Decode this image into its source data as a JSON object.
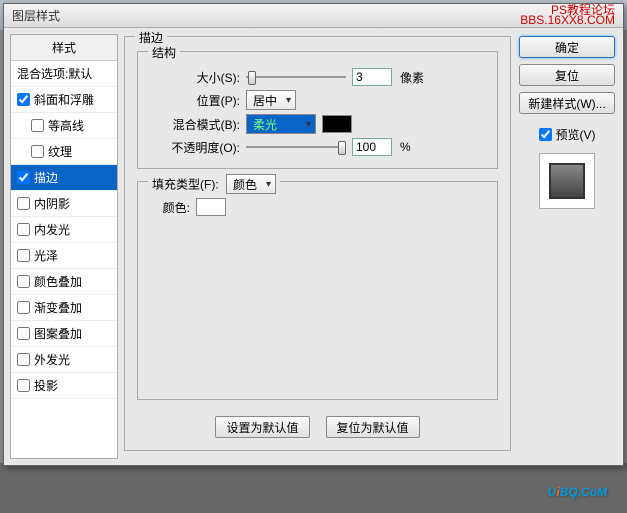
{
  "titlebar": {
    "title": "图层样式",
    "right1": "PS教程论坛",
    "right2": "BBS.16XX8.COM"
  },
  "left": {
    "header": "样式",
    "blend_defaults": "混合选项:默认",
    "items": [
      {
        "label": "斜面和浮雕",
        "checked": true,
        "indent": false
      },
      {
        "label": "等高线",
        "checked": false,
        "indent": true
      },
      {
        "label": "纹理",
        "checked": false,
        "indent": true
      },
      {
        "label": "描边",
        "checked": true,
        "indent": false,
        "selected": true
      },
      {
        "label": "内阴影",
        "checked": false,
        "indent": false
      },
      {
        "label": "内发光",
        "checked": false,
        "indent": false
      },
      {
        "label": "光泽",
        "checked": false,
        "indent": false
      },
      {
        "label": "颜色叠加",
        "checked": false,
        "indent": false
      },
      {
        "label": "渐变叠加",
        "checked": false,
        "indent": false
      },
      {
        "label": "图案叠加",
        "checked": false,
        "indent": false
      },
      {
        "label": "外发光",
        "checked": false,
        "indent": false
      },
      {
        "label": "投影",
        "checked": false,
        "indent": false
      }
    ]
  },
  "mid": {
    "section_title": "描边",
    "structure_title": "结构",
    "size_label": "大小(S):",
    "size_value": "3",
    "size_unit": "像素",
    "position_label": "位置(P):",
    "position_value": "居中",
    "blend_label": "混合模式(B):",
    "blend_value": "柔光",
    "opacity_label": "不透明度(O):",
    "opacity_value": "100",
    "opacity_unit": "%",
    "filltype_title_label": "填充类型(F):",
    "filltype_value": "颜色",
    "color_label": "颜色:",
    "set_default": "设置为默认值",
    "reset_default": "复位为默认值"
  },
  "right": {
    "ok": "确定",
    "cancel": "复位",
    "new_style": "新建样式(W)...",
    "preview": "预览(V)"
  },
  "watermark": {
    "text_pre": "U",
    "text_i": "i",
    "text_post": "BQ.CoM"
  }
}
